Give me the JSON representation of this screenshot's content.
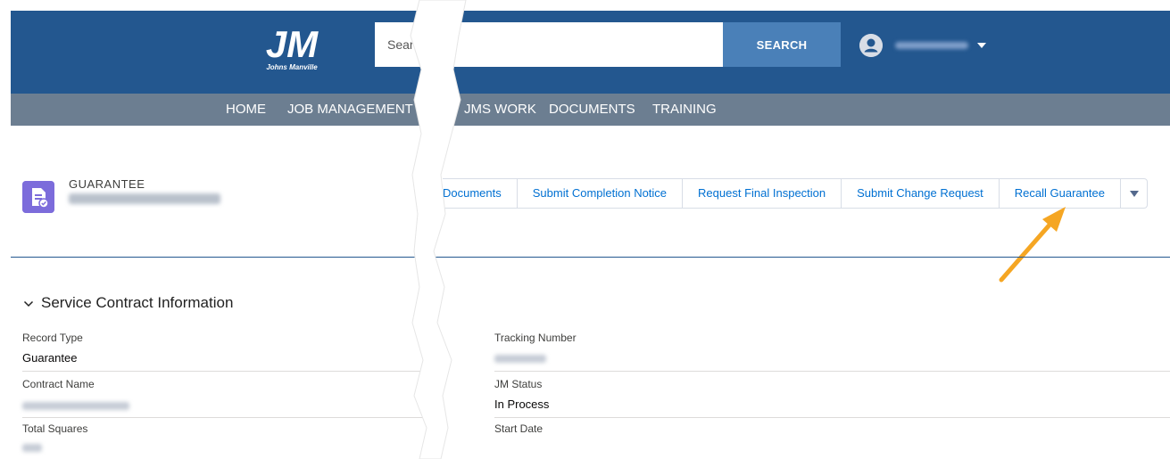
{
  "header": {
    "logo_text": "JM",
    "logo_subtitle": "Johns Manville",
    "search_placeholder": "Search",
    "search_button": "SEARCH"
  },
  "nav": {
    "items": [
      "HOME",
      "JOB MANAGEMENT",
      "JMS WORK",
      "DOCUMENTS",
      "TRAINING"
    ]
  },
  "record": {
    "type_label": "GUARANTEE"
  },
  "actions": {
    "items": [
      "Documents",
      "Submit Completion Notice",
      "Request Final Inspection",
      "Submit Change Request",
      "Recall Guarantee"
    ]
  },
  "section": {
    "title": "Service Contract Information",
    "fields_left": [
      {
        "label": "Record Type",
        "value": "Guarantee"
      },
      {
        "label": "Contract Name",
        "value": ""
      },
      {
        "label": "Total Squares",
        "value": ""
      }
    ],
    "fields_right": [
      {
        "label": "Tracking Number",
        "value": ""
      },
      {
        "label": "JM Status",
        "value": "In Process"
      },
      {
        "label": "Start Date",
        "value": ""
      }
    ]
  },
  "colors": {
    "header_bg": "#23578f",
    "nav_bg": "#6c7e91",
    "link": "#0070d2",
    "annotation_arrow": "#f5a623"
  }
}
